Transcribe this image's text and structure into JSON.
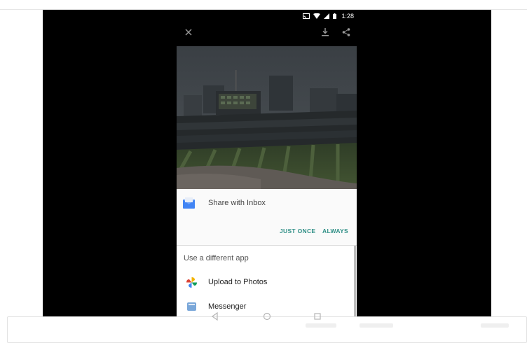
{
  "status_bar": {
    "time": "1:28",
    "icons": [
      "cast-icon",
      "wifi-icon",
      "signal-icon",
      "battery-icon"
    ]
  },
  "viewer": {
    "close_icon": "close-icon",
    "download_icon": "download-icon",
    "share_icon": "share-icon"
  },
  "share_sheet": {
    "inbox_label": "Share with Inbox",
    "just_once": "JUST ONCE",
    "always": "ALWAYS",
    "different_app_label": "Use a different app",
    "apps": [
      {
        "label": "Upload to Photos",
        "icon": "photos-pinwheel-icon"
      },
      {
        "label": "Messenger",
        "icon": "messenger-icon"
      }
    ]
  },
  "nav_bar": {
    "icons": [
      "back-icon",
      "home-icon",
      "recents-icon"
    ]
  },
  "colors": {
    "accent": "#2f8f86",
    "inbox_blue": "#4285f4",
    "screen_black": "#000000"
  }
}
